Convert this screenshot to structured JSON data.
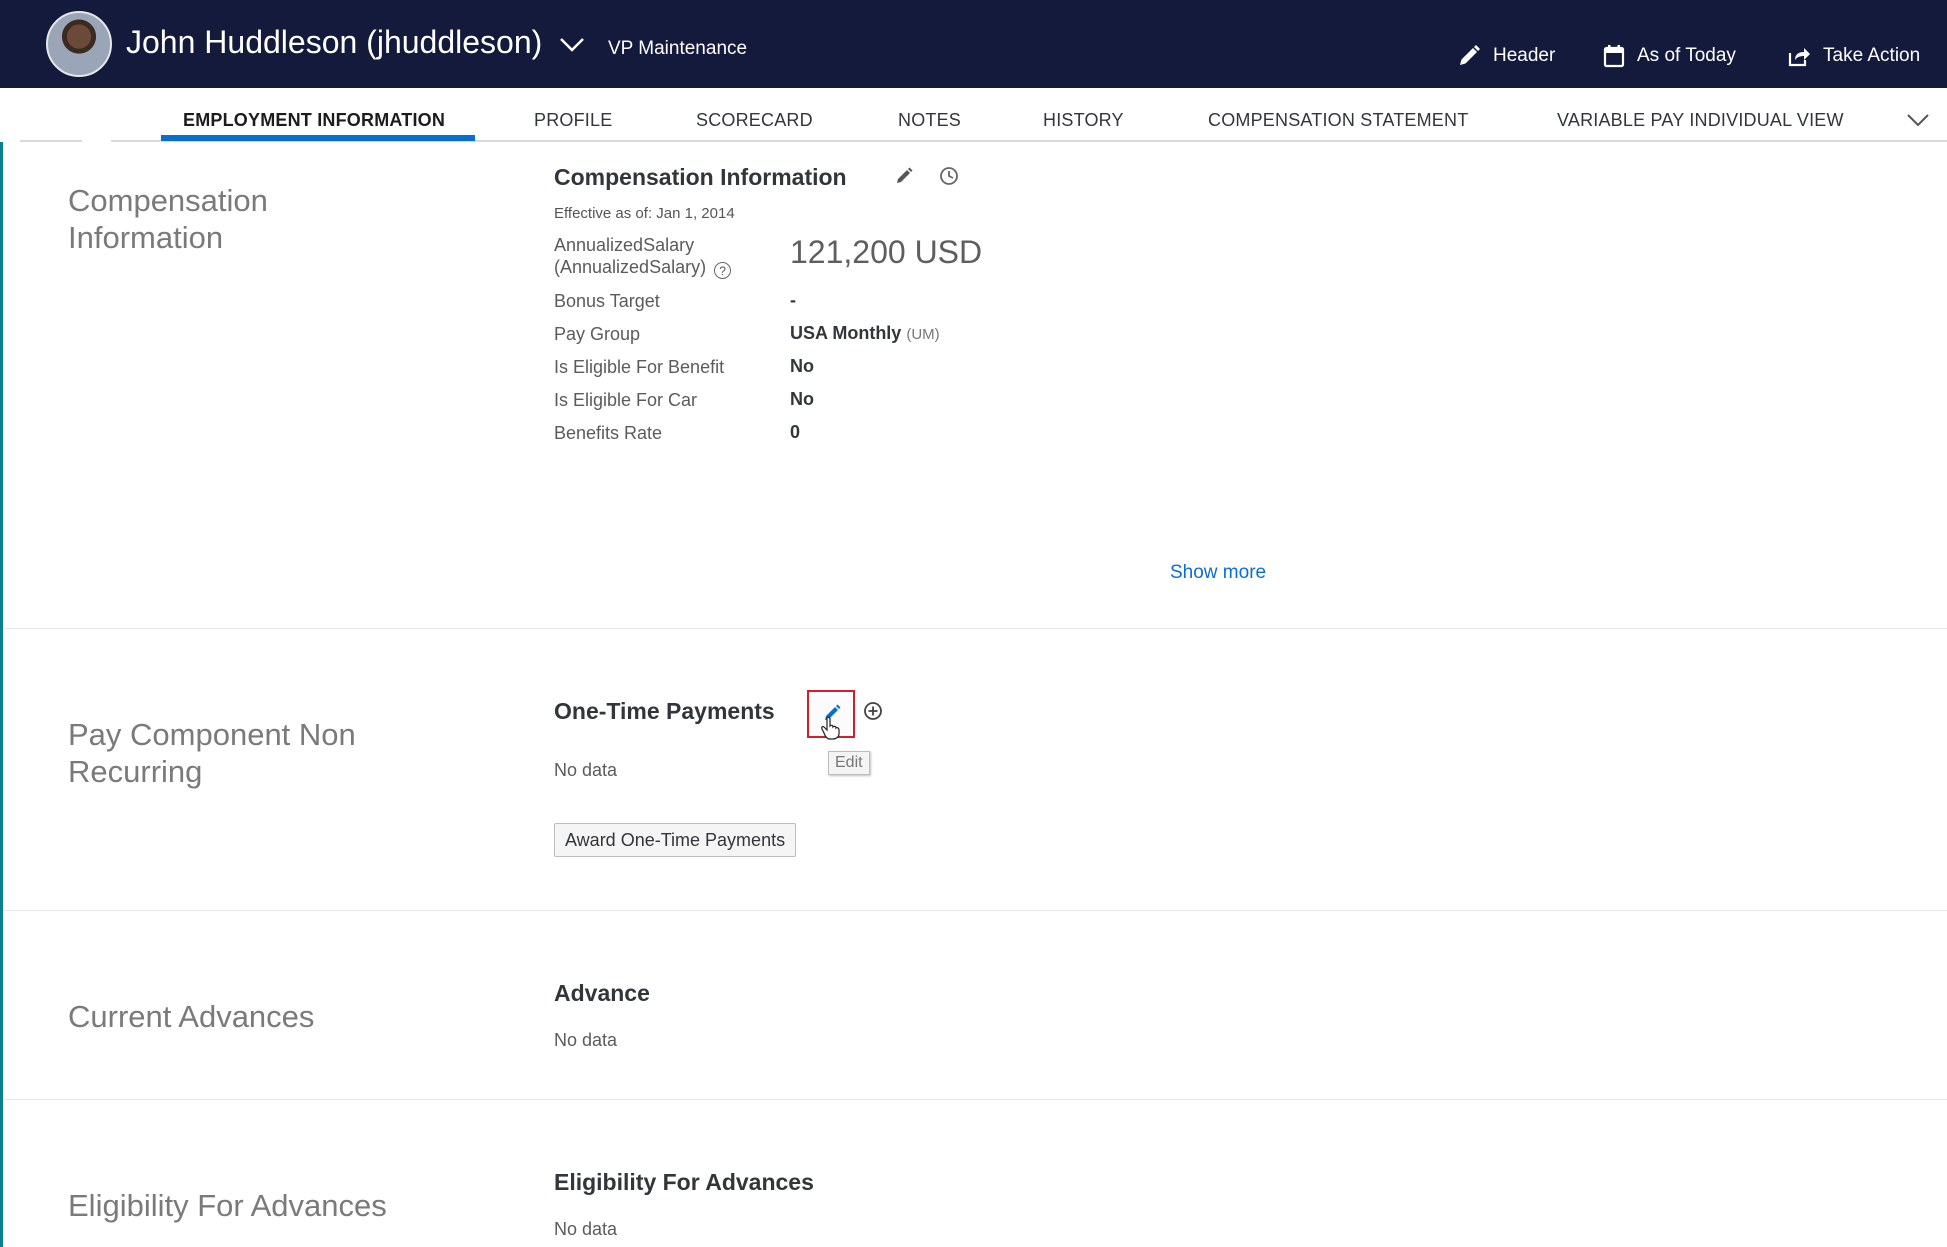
{
  "header": {
    "employee_name": "John Huddleson (jhuddleson)",
    "employee_title": "VP Maintenance",
    "actions": {
      "header_label": "Header",
      "as_of_label": "As of Today",
      "take_action_label": "Take Action"
    }
  },
  "tabs": [
    {
      "label": "EMPLOYMENT INFORMATION",
      "active": true
    },
    {
      "label": "PROFILE"
    },
    {
      "label": "SCORECARD"
    },
    {
      "label": "NOTES"
    },
    {
      "label": "HISTORY"
    },
    {
      "label": "COMPENSATION STATEMENT"
    },
    {
      "label": "VARIABLE PAY INDIVIDUAL VIEW"
    }
  ],
  "compensation": {
    "section_title_line1": "Compensation",
    "section_title_line2": "Information",
    "card_title": "Compensation Information",
    "effective": "Effective as of: Jan 1, 2014",
    "annualized_label_line1": "AnnualizedSalary",
    "annualized_label_line2": "(AnnualizedSalary)",
    "annualized_value": "121,200 USD",
    "rows": [
      {
        "label": "Bonus Target",
        "value": "-"
      },
      {
        "label": "Pay Group",
        "value": "USA Monthly",
        "suffix": "(UM)"
      },
      {
        "label": "Is Eligible For Benefit",
        "value": "No"
      },
      {
        "label": "Is Eligible For Car",
        "value": "No"
      },
      {
        "label": "Benefits Rate",
        "value": "0"
      }
    ],
    "show_more": "Show more"
  },
  "pay_component": {
    "section_title_line1": "Pay Component Non",
    "section_title_line2": "Recurring",
    "card_title": "One-Time Payments",
    "empty": "No data",
    "tooltip": "Edit",
    "award_button": "Award One-Time Payments"
  },
  "advances": {
    "section_title": "Current Advances",
    "card_title": "Advance",
    "empty": "No data"
  },
  "eligibility": {
    "section_title": "Eligibility For Advances",
    "card_title": "Eligibility For Advances",
    "empty": "No data"
  },
  "colors": {
    "header_bg": "#141a3c",
    "accent": "#0a6ed1",
    "highlight": "#d0202a"
  }
}
